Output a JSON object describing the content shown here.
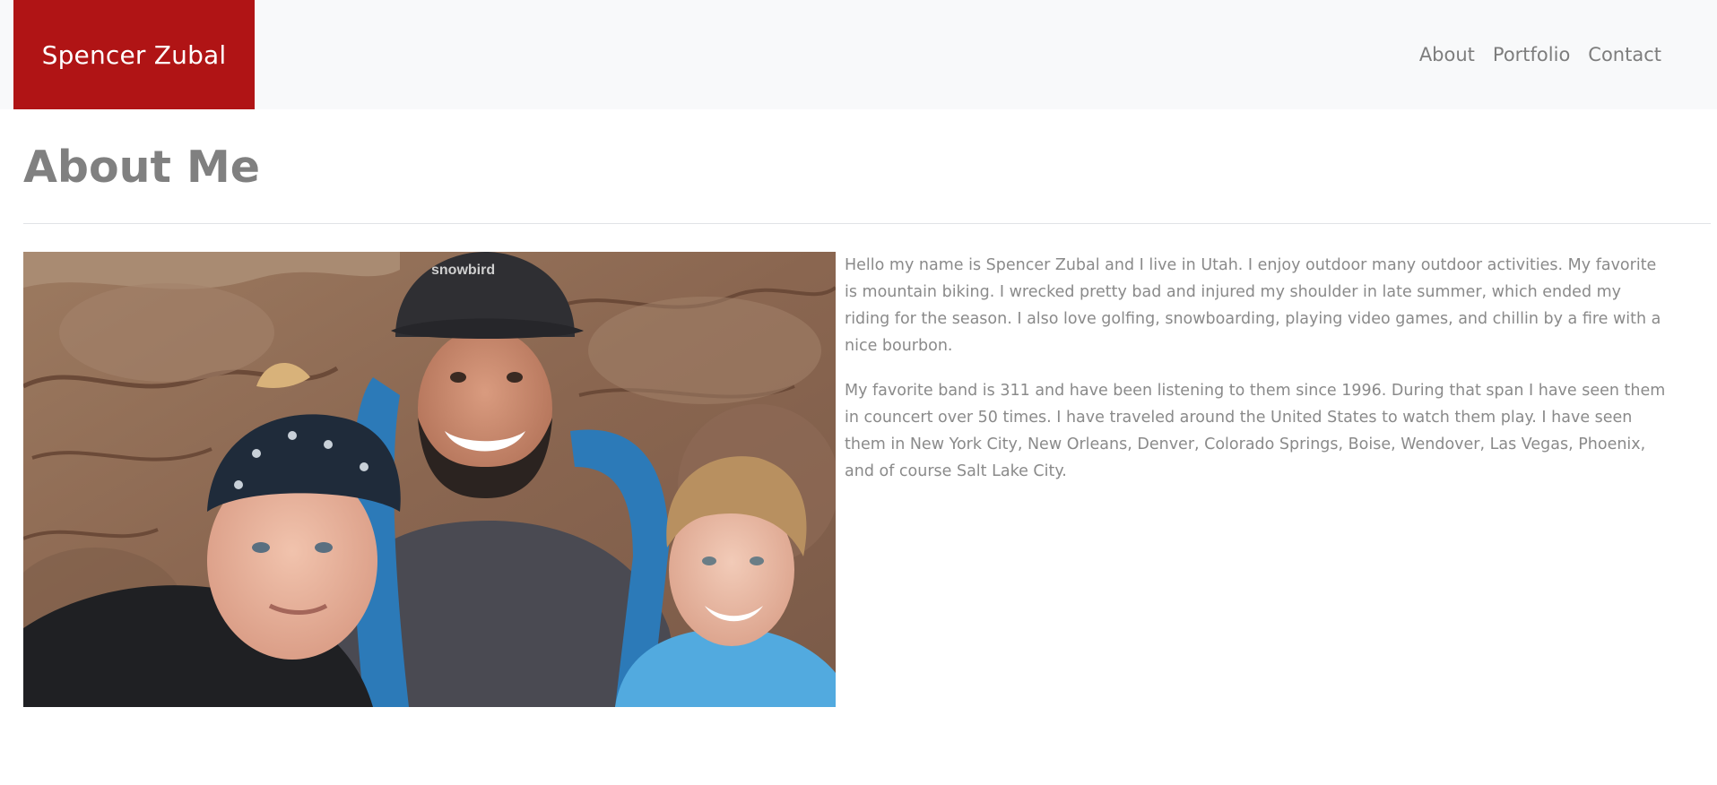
{
  "navbar": {
    "brand": "Spencer Zubal",
    "brand_color": "#b01415",
    "links": [
      {
        "label": "About"
      },
      {
        "label": "Portfolio"
      },
      {
        "label": "Contact"
      }
    ]
  },
  "main": {
    "title": "About Me",
    "photo": {
      "content": "family selfie: woman in patterned headband, bearded man in black snowbird cap and grey t-shirt, smiling boy in light blue shirt, red sandstone canyon rock behind",
      "cap_text": "snowbird"
    },
    "paragraphs": [
      "Hello my name is Spencer Zubal and I live in Utah. I enjoy outdoor many outdoor activities. My favorite is mountain biking. I wrecked pretty bad and injured my shoulder in late summer, which ended my riding for the season. I also love golfing, snowboarding, playing video games, and chillin by a fire with a nice bourbon.",
      "My favorite band is 311 and have been listening to them since 1996. During that span I have seen them in councert over 50 times. I have traveled around the United States to watch them play. I have seen them in New York City, New Orleans, Denver, Colorado Springs, Boise, Wendover, Las Vegas, Phoenix, and of course Salt Lake City."
    ]
  }
}
